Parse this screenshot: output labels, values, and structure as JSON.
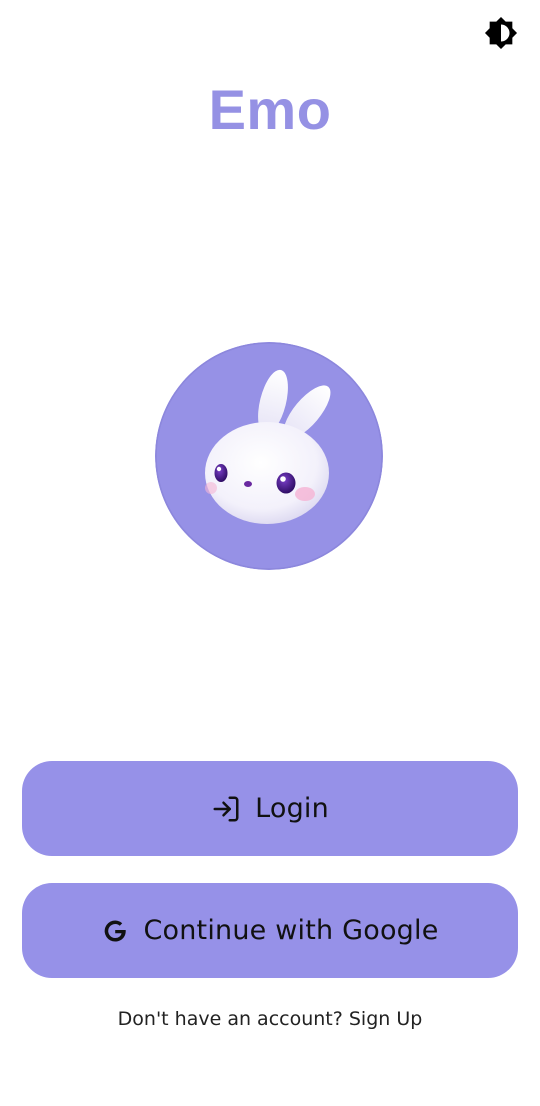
{
  "header": {
    "theme_toggle_icon": "brightness-contrast-icon"
  },
  "app": {
    "title": "Emo",
    "brand_color": "#9591e4",
    "logo_icon": "bunny-mascot-icon"
  },
  "actions": {
    "login_label": "Login",
    "login_icon": "login-arrow-icon",
    "google_label": "Continue with Google",
    "google_icon": "google-g-icon",
    "button_color": "#9691e8"
  },
  "footer": {
    "prompt": "Don't have an account?",
    "signup_link": "Sign Up"
  }
}
